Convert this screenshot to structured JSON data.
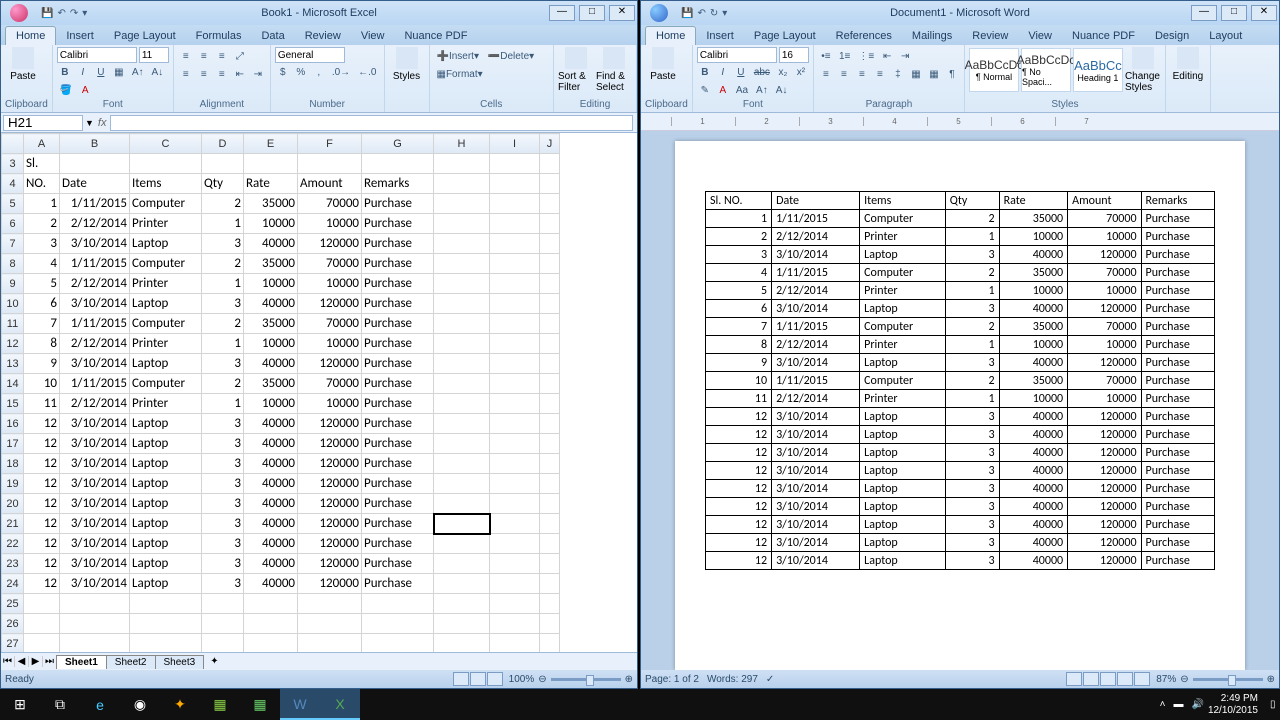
{
  "excel": {
    "title": "Book1 - Microsoft Excel",
    "name_box": "H21",
    "formula": "",
    "tabs": [
      "Home",
      "Insert",
      "Page Layout",
      "Formulas",
      "Data",
      "Review",
      "View",
      "Nuance PDF"
    ],
    "active_tab": "Home",
    "font_name": "Calibri",
    "font_size": "11",
    "number_format": "General",
    "groups": {
      "clipboard": "Clipboard",
      "font": "Font",
      "alignment": "Alignment",
      "number": "Number",
      "styles": "Styles",
      "cells": "Cells",
      "editing": "Editing"
    },
    "cells_labels": {
      "insert": "Insert",
      "delete": "Delete",
      "format": "Format"
    },
    "editing_labels": {
      "sort": "Sort & Filter",
      "find": "Find & Select"
    },
    "paste_label": "Paste",
    "styles_label": "Styles",
    "columns": [
      "A",
      "B",
      "C",
      "D",
      "E",
      "F",
      "G",
      "H",
      "I",
      "J"
    ],
    "headers": {
      "A": "Sl. NO.",
      "B": "Date",
      "C": "Items",
      "D": "Qty",
      "E": "Rate",
      "F": "Amount",
      "G": "Remarks"
    },
    "rows": [
      {
        "n": 1,
        "d": "1/11/2015",
        "i": "Computer",
        "q": 2,
        "r": 35000,
        "a": 70000,
        "rm": "Purchase"
      },
      {
        "n": 2,
        "d": "2/12/2014",
        "i": "Printer",
        "q": 1,
        "r": 10000,
        "a": 10000,
        "rm": "Purchase"
      },
      {
        "n": 3,
        "d": "3/10/2014",
        "i": "Laptop",
        "q": 3,
        "r": 40000,
        "a": 120000,
        "rm": "Purchase"
      },
      {
        "n": 4,
        "d": "1/11/2015",
        "i": "Computer",
        "q": 2,
        "r": 35000,
        "a": 70000,
        "rm": "Purchase"
      },
      {
        "n": 5,
        "d": "2/12/2014",
        "i": "Printer",
        "q": 1,
        "r": 10000,
        "a": 10000,
        "rm": "Purchase"
      },
      {
        "n": 6,
        "d": "3/10/2014",
        "i": "Laptop",
        "q": 3,
        "r": 40000,
        "a": 120000,
        "rm": "Purchase"
      },
      {
        "n": 7,
        "d": "1/11/2015",
        "i": "Computer",
        "q": 2,
        "r": 35000,
        "a": 70000,
        "rm": "Purchase"
      },
      {
        "n": 8,
        "d": "2/12/2014",
        "i": "Printer",
        "q": 1,
        "r": 10000,
        "a": 10000,
        "rm": "Purchase"
      },
      {
        "n": 9,
        "d": "3/10/2014",
        "i": "Laptop",
        "q": 3,
        "r": 40000,
        "a": 120000,
        "rm": "Purchase"
      },
      {
        "n": 10,
        "d": "1/11/2015",
        "i": "Computer",
        "q": 2,
        "r": 35000,
        "a": 70000,
        "rm": "Purchase"
      },
      {
        "n": 11,
        "d": "2/12/2014",
        "i": "Printer",
        "q": 1,
        "r": 10000,
        "a": 10000,
        "rm": "Purchase"
      },
      {
        "n": 12,
        "d": "3/10/2014",
        "i": "Laptop",
        "q": 3,
        "r": 40000,
        "a": 120000,
        "rm": "Purchase"
      },
      {
        "n": 12,
        "d": "3/10/2014",
        "i": "Laptop",
        "q": 3,
        "r": 40000,
        "a": 120000,
        "rm": "Purchase"
      },
      {
        "n": 12,
        "d": "3/10/2014",
        "i": "Laptop",
        "q": 3,
        "r": 40000,
        "a": 120000,
        "rm": "Purchase"
      },
      {
        "n": 12,
        "d": "3/10/2014",
        "i": "Laptop",
        "q": 3,
        "r": 40000,
        "a": 120000,
        "rm": "Purchase"
      },
      {
        "n": 12,
        "d": "3/10/2014",
        "i": "Laptop",
        "q": 3,
        "r": 40000,
        "a": 120000,
        "rm": "Purchase"
      },
      {
        "n": 12,
        "d": "3/10/2014",
        "i": "Laptop",
        "q": 3,
        "r": 40000,
        "a": 120000,
        "rm": "Purchase"
      },
      {
        "n": 12,
        "d": "3/10/2014",
        "i": "Laptop",
        "q": 3,
        "r": 40000,
        "a": 120000,
        "rm": "Purchase"
      },
      {
        "n": 12,
        "d": "3/10/2014",
        "i": "Laptop",
        "q": 3,
        "r": 40000,
        "a": 120000,
        "rm": "Purchase"
      },
      {
        "n": 12,
        "d": "3/10/2014",
        "i": "Laptop",
        "q": 3,
        "r": 40000,
        "a": 120000,
        "rm": "Purchase"
      }
    ],
    "sheets": [
      "Sheet1",
      "Sheet2",
      "Sheet3"
    ],
    "active_sheet": "Sheet1",
    "status": "Ready",
    "zoom": "100%"
  },
  "word": {
    "title": "Document1 - Microsoft Word",
    "tabs": [
      "Home",
      "Insert",
      "Page Layout",
      "References",
      "Mailings",
      "Review",
      "View",
      "Nuance PDF",
      "Design",
      "Layout"
    ],
    "active_tab": "Home",
    "font_name": "Calibri",
    "font_size": "16",
    "groups": {
      "clipboard": "Clipboard",
      "font": "Font",
      "paragraph": "Paragraph",
      "styles": "Styles",
      "editing": "Editing"
    },
    "paste_label": "Paste",
    "styles_labels": {
      "normal": "¶ Normal",
      "nospacing": "¶ No Spaci...",
      "heading1": "Heading 1"
    },
    "change_styles": "Change Styles",
    "headers": [
      "Sl. NO.",
      "Date",
      "Items",
      "Qty",
      "Rate",
      "Amount",
      "Remarks"
    ],
    "rows": [
      {
        "n": 1,
        "d": "1/11/2015",
        "i": "Computer",
        "q": 2,
        "r": 35000,
        "a": 70000,
        "rm": "Purchase"
      },
      {
        "n": 2,
        "d": "2/12/2014",
        "i": "Printer",
        "q": 1,
        "r": 10000,
        "a": 10000,
        "rm": "Purchase"
      },
      {
        "n": 3,
        "d": "3/10/2014",
        "i": "Laptop",
        "q": 3,
        "r": 40000,
        "a": 120000,
        "rm": "Purchase"
      },
      {
        "n": 4,
        "d": "1/11/2015",
        "i": "Computer",
        "q": 2,
        "r": 35000,
        "a": 70000,
        "rm": "Purchase"
      },
      {
        "n": 5,
        "d": "2/12/2014",
        "i": "Printer",
        "q": 1,
        "r": 10000,
        "a": 10000,
        "rm": "Purchase"
      },
      {
        "n": 6,
        "d": "3/10/2014",
        "i": "Laptop",
        "q": 3,
        "r": 40000,
        "a": 120000,
        "rm": "Purchase"
      },
      {
        "n": 7,
        "d": "1/11/2015",
        "i": "Computer",
        "q": 2,
        "r": 35000,
        "a": 70000,
        "rm": "Purchase"
      },
      {
        "n": 8,
        "d": "2/12/2014",
        "i": "Printer",
        "q": 1,
        "r": 10000,
        "a": 10000,
        "rm": "Purchase"
      },
      {
        "n": 9,
        "d": "3/10/2014",
        "i": "Laptop",
        "q": 3,
        "r": 40000,
        "a": 120000,
        "rm": "Purchase"
      },
      {
        "n": 10,
        "d": "1/11/2015",
        "i": "Computer",
        "q": 2,
        "r": 35000,
        "a": 70000,
        "rm": "Purchase"
      },
      {
        "n": 11,
        "d": "2/12/2014",
        "i": "Printer",
        "q": 1,
        "r": 10000,
        "a": 10000,
        "rm": "Purchase"
      },
      {
        "n": 12,
        "d": "3/10/2014",
        "i": "Laptop",
        "q": 3,
        "r": 40000,
        "a": 120000,
        "rm": "Purchase"
      },
      {
        "n": 12,
        "d": "3/10/2014",
        "i": "Laptop",
        "q": 3,
        "r": 40000,
        "a": 120000,
        "rm": "Purchase"
      },
      {
        "n": 12,
        "d": "3/10/2014",
        "i": "Laptop",
        "q": 3,
        "r": 40000,
        "a": 120000,
        "rm": "Purchase"
      },
      {
        "n": 12,
        "d": "3/10/2014",
        "i": "Laptop",
        "q": 3,
        "r": 40000,
        "a": 120000,
        "rm": "Purchase"
      },
      {
        "n": 12,
        "d": "3/10/2014",
        "i": "Laptop",
        "q": 3,
        "r": 40000,
        "a": 120000,
        "rm": "Purchase"
      },
      {
        "n": 12,
        "d": "3/10/2014",
        "i": "Laptop",
        "q": 3,
        "r": 40000,
        "a": 120000,
        "rm": "Purchase"
      },
      {
        "n": 12,
        "d": "3/10/2014",
        "i": "Laptop",
        "q": 3,
        "r": 40000,
        "a": 120000,
        "rm": "Purchase"
      },
      {
        "n": 12,
        "d": "3/10/2014",
        "i": "Laptop",
        "q": 3,
        "r": 40000,
        "a": 120000,
        "rm": "Purchase"
      },
      {
        "n": 12,
        "d": "3/10/2014",
        "i": "Laptop",
        "q": 3,
        "r": 40000,
        "a": 120000,
        "rm": "Purchase"
      }
    ],
    "status_page": "Page: 1 of 2",
    "status_words": "Words: 297",
    "zoom": "87%"
  },
  "taskbar": {
    "time": "2:49 PM",
    "date": "12/10/2015"
  }
}
